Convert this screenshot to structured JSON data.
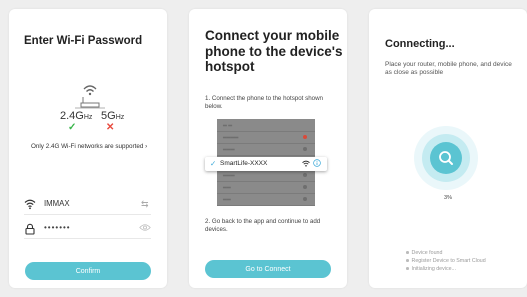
{
  "screen1": {
    "title": "Enter Wi-Fi Password",
    "band_24": "2.4G",
    "band_24_unit": "Hz",
    "band_5": "5G",
    "band_5_unit": "Hz",
    "mark_ok": "✓",
    "mark_no": "✕",
    "note": "Only 2.4G Wi-Fi networks are supported",
    "ssid": "IMMAX",
    "switch_icon": "⇆",
    "password": "•••••••",
    "confirm_label": "Confirm"
  },
  "screen2": {
    "title": "Connect your mobile phone to the device's hotspot",
    "step1": "1. Connect the phone to the hotspot shown below.",
    "network_name": "SmartLife-XXXX",
    "step2": "2. Go back to the app and continue to add devices.",
    "button_label": "Go to Connect"
  },
  "screen3": {
    "title": "Connecting...",
    "subtitle": "Place your router, mobile phone, and device as close as possible",
    "progress_label": "3%",
    "progress_value": 3,
    "status_items": [
      "Device found",
      "Register Device to Smart Cloud",
      "Initializing device..."
    ]
  },
  "colors": {
    "accent": "#5bc4d2",
    "ok": "#39b54a",
    "error": "#e84a3e"
  }
}
